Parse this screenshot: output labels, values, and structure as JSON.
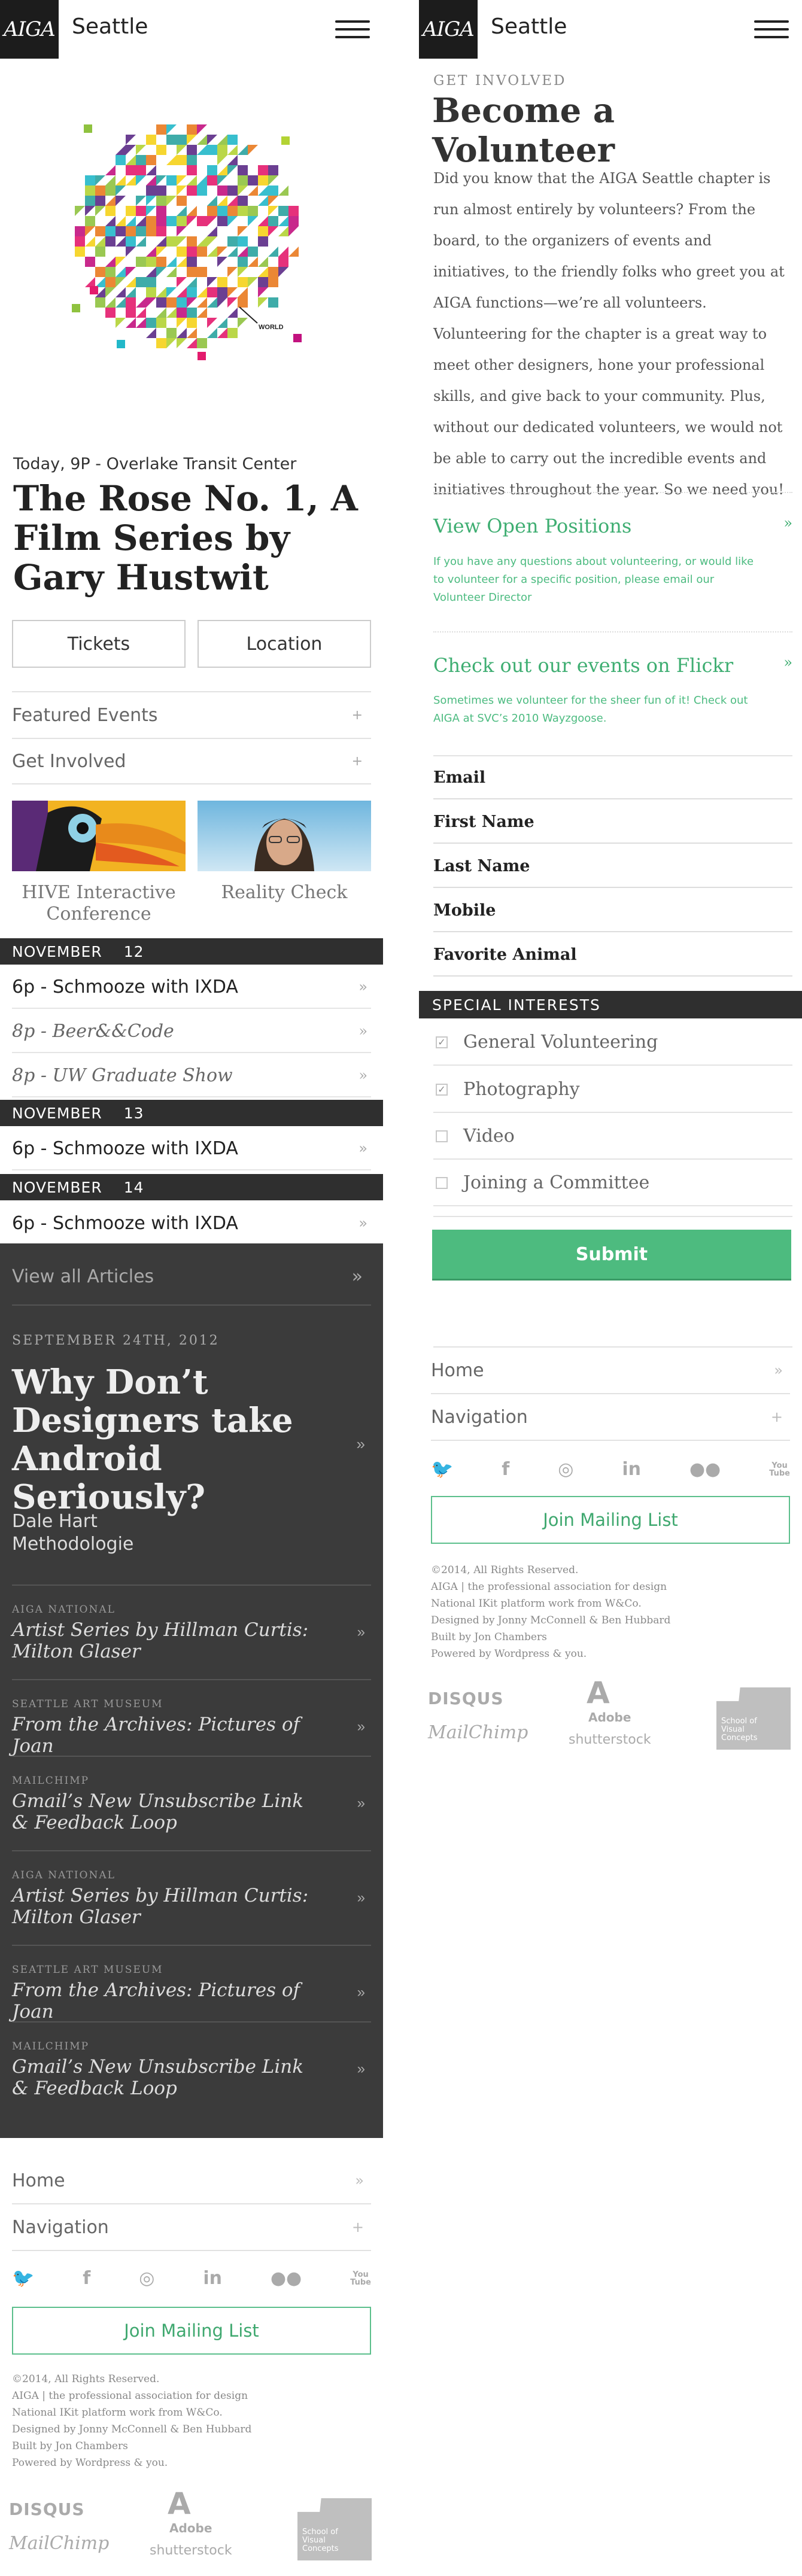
{
  "header": {
    "logo": "AIGA",
    "city": "Seattle"
  },
  "hero": {
    "event_date": "Today, 9P - Overlake Transit Center",
    "event_title": "The Rose No. 1,  A Film Series by Gary Hustwit",
    "art_label": "WORLD",
    "tickets_label": "Tickets",
    "location_label": "Location"
  },
  "accordions": [
    {
      "label": "Featured Events",
      "icon": "+"
    },
    {
      "label": "Get Involved",
      "icon": "+"
    }
  ],
  "features": [
    {
      "caption": "HIVE Interactive Conference"
    },
    {
      "caption": "Reality Check"
    }
  ],
  "calendar": {
    "month": "NOVEMBER",
    "days": [
      {
        "day": "12",
        "events": [
          {
            "label": "6p - Schmooze with IXDA",
            "style": "normal"
          },
          {
            "label": "8p - Beer&&Code",
            "style": "italic"
          },
          {
            "label": "8p - UW Graduate Show",
            "style": "italic"
          }
        ]
      },
      {
        "day": "13",
        "events": [
          {
            "label": "6p - Schmooze with IXDA",
            "style": "normal"
          }
        ]
      },
      {
        "day": "14",
        "events": [
          {
            "label": "6p - Schmooze with IXDA",
            "style": "normal"
          }
        ]
      }
    ],
    "chevron": "»"
  },
  "articles": {
    "view_all": "View all Articles",
    "featured": {
      "date": "SEPTEMBER 24TH, 2012",
      "title": "Why Don’t Designers take Android Seriously?",
      "author_line1": "Dale Hart",
      "author_line2": "Methodologie"
    },
    "list": [
      {
        "source": "AIGA NATIONAL",
        "title": "Artist Series by Hillman Curtis: Milton Glaser"
      },
      {
        "source": "SEATTLE ART MUSEUM",
        "title": "From the Archives: Pictures of Joan"
      },
      {
        "source": "MAILCHIMP",
        "title": "Gmail’s New Unsubscribe Link & Feedback Loop"
      },
      {
        "source": "AIGA NATIONAL",
        "title": "Artist Series by Hillman Curtis: Milton Glaser"
      },
      {
        "source": "SEATTLE ART MUSEUM",
        "title": "From the Archives: Pictures of Joan"
      },
      {
        "source": "MAILCHIMP",
        "title": "Gmail’s New Unsubscribe Link & Feedback Loop"
      }
    ]
  },
  "footer": {
    "home": "Home",
    "home_icon": "»",
    "navigation": "Navigation",
    "navigation_icon": "+",
    "social": [
      "twitter-icon",
      "facebook-icon",
      "instagram-icon",
      "linkedin-icon",
      "flickr-icon",
      "youtube-icon"
    ],
    "social_glyphs": {
      "tw": "🐦",
      "fb": "f",
      "ig": "◎",
      "li": "in",
      "fl": "●●",
      "yt": "You\nTube"
    },
    "mailing_list": "Join Mailing List",
    "legal": [
      "©2014, All Rights Reserved.",
      "AIGA | the professional association for design",
      "National IKit platform work from W&Co.",
      "Designed by Jonny McConnell & Ben Hubbard",
      "Built by Jon Chambers",
      "Powered by Wordpress & you."
    ],
    "sponsors": {
      "disqus": "DISQUS",
      "mailchimp": "MailChimp",
      "adobe": "Adobe",
      "shutterstock": "shutterstock",
      "school": "School of Visual Concepts"
    }
  },
  "volunteer": {
    "eyebrow": "GET INVOLVED",
    "title": "Become a Volunteer",
    "intro": "Did you know that the AIGA Seattle chapter is run almost entirely by volunteers? From the board, to the organizers of events and initiatives, to the friendly folks who greet you at AIGA functions—we’re all volunteers. Volunteering for the chapter is a great way to meet other designers, hone your professional skills, and give back to your community. Plus, without our dedicated volunteers, we would not be able to carry out the incredible events and initiatives throughout the year. So we need you!",
    "positions_link": "View Open Positions",
    "positions_note": "If you have any questions about volunteering, or would like to volunteer for a specific position, please email our Volunteer Director",
    "flickr_link": "Check out our events on Flickr",
    "flickr_note": "Sometimes we volunteer for the sheer fun of it! Check out AIGA at SVC’s 2010 Wayzgoose.",
    "link_chevron": "»",
    "fields": [
      "Email",
      "First Name",
      "Last Name",
      "Mobile",
      "Favorite Animal"
    ],
    "special_interests_label": "SPECIAL INTERESTS",
    "interests": [
      {
        "label": "General Volunteering",
        "checked": true
      },
      {
        "label": "Photography",
        "checked": true
      },
      {
        "label": "Video",
        "checked": false
      },
      {
        "label": "Joining a Committee",
        "checked": false
      }
    ],
    "submit": "Submit"
  },
  "colors": {
    "accent_green": "#4dbb7f",
    "dark_panel": "#3b3b3b",
    "bar_dark": "#2f2f2f"
  }
}
